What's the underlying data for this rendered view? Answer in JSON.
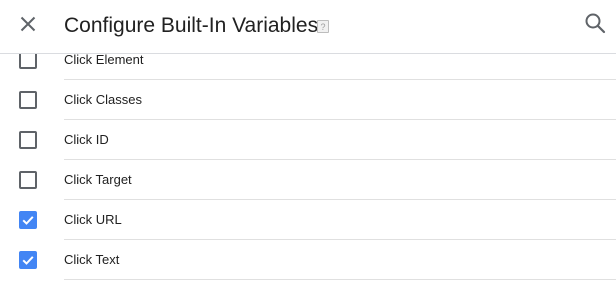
{
  "header": {
    "title": "Configure Built-In Variables",
    "help_badge": "?",
    "close_icon": "close-icon",
    "search_icon": "search-icon"
  },
  "variables": [
    {
      "label": "Click Element",
      "checked": false
    },
    {
      "label": "Click Classes",
      "checked": false
    },
    {
      "label": "Click ID",
      "checked": false
    },
    {
      "label": "Click Target",
      "checked": false
    },
    {
      "label": "Click URL",
      "checked": true
    },
    {
      "label": "Click Text",
      "checked": true
    }
  ],
  "colors": {
    "checkbox_checked": "#4285f4",
    "checkbox_unchecked_border": "#5f6368",
    "divider": "#e0e0e0"
  }
}
